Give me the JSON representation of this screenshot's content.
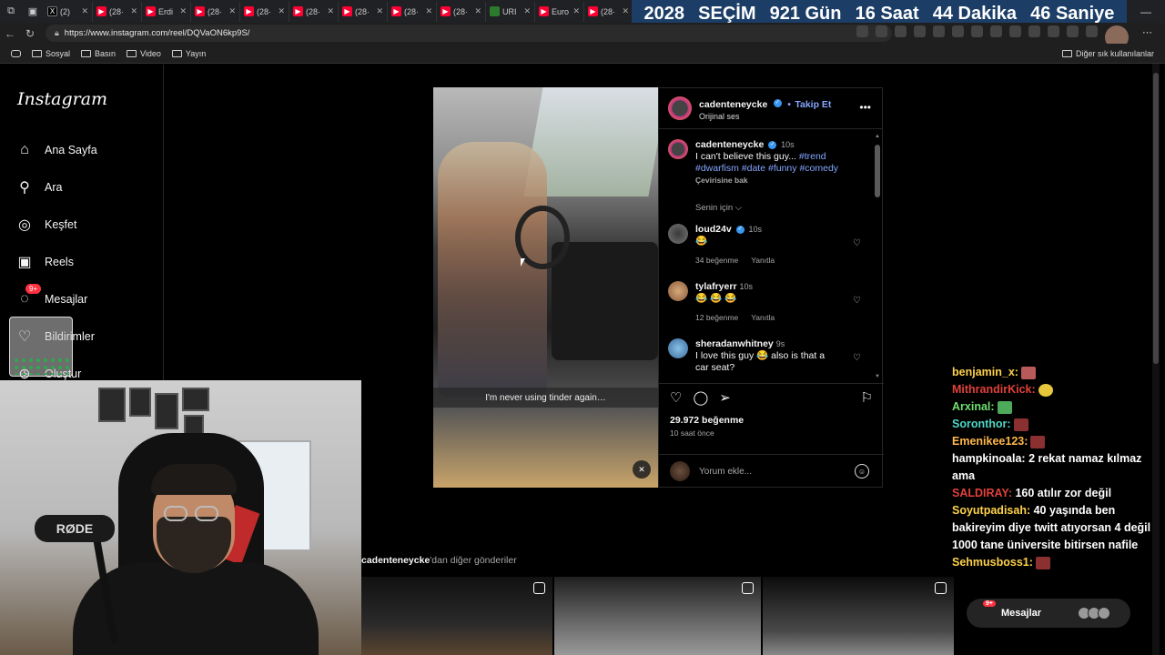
{
  "browser": {
    "tabs": [
      {
        "label": "(2)",
        "fav": "x"
      },
      {
        "label": "(28·",
        "fav": "yt"
      },
      {
        "label": "Erdi",
        "fav": "yt"
      },
      {
        "label": "(28·",
        "fav": "yt"
      },
      {
        "label": "(28·",
        "fav": "yt"
      },
      {
        "label": "(28·",
        "fav": "yt"
      },
      {
        "label": "(28·",
        "fav": "yt"
      },
      {
        "label": "(28·",
        "fav": "yt"
      },
      {
        "label": "(28·",
        "fav": "yt"
      },
      {
        "label": "URI",
        "fav": "gh"
      },
      {
        "label": "Euro",
        "fav": "yt"
      },
      {
        "label": "(28·",
        "fav": "yt"
      }
    ],
    "url": "https://www.instagram.com/reel/DQVaON6kp9S/",
    "bookmarks": [
      "Sosyal",
      "Basın",
      "Video",
      "Yayın"
    ],
    "other_bookmarks": "Diğer sık kullanılanlar"
  },
  "countdown": {
    "year": "2028",
    "label": "SEÇİM",
    "days": "921 Gün",
    "hours": "16 Saat",
    "minutes": "44 Dakika",
    "seconds": "46 Saniye"
  },
  "instagram": {
    "logo": "Instagram",
    "nav": [
      {
        "label": "Ana Sayfa",
        "icon": "home-icon"
      },
      {
        "label": "Ara",
        "icon": "search-icon"
      },
      {
        "label": "Keşfet",
        "icon": "compass-icon"
      },
      {
        "label": "Reels",
        "icon": "reels-icon"
      },
      {
        "label": "Mesajlar",
        "icon": "messenger-icon",
        "badge": "9+"
      },
      {
        "label": "Bildirimler",
        "icon": "heart-icon"
      },
      {
        "label": "Oluştur",
        "icon": "plus-icon"
      }
    ],
    "post": {
      "video_caption": "I'm never using tinder again…",
      "author": "cadenteneycke",
      "follow": "Takip Et",
      "dot": "•",
      "audio": "Orijinal ses",
      "caption_user": "cadenteneycke",
      "caption_time": "10s",
      "caption_text": "I can't believe this guy...",
      "hashtags": [
        "#trend",
        "#dwarfism",
        "#date",
        "#funny",
        "#comedy"
      ],
      "translate": "Çevirisine bak",
      "sort": "Senin için",
      "comments": [
        {
          "user": "loud24v",
          "verified": true,
          "time": "10s",
          "text": "😂",
          "likes": "34 beğenme",
          "reply": "Yanıtla"
        },
        {
          "user": "tylafryerr",
          "verified": false,
          "time": "10s",
          "text": "😂 😂 😂",
          "likes": "12 beğenme",
          "reply": "Yanıtla"
        },
        {
          "user": "sheradanwhitney",
          "verified": false,
          "time": "9s",
          "text_a": "I love this guy",
          "emoji": "😂",
          "text_b": "also is that a car seat?"
        }
      ],
      "likes": "29.972 beğenme",
      "time_ago": "10 saat önce",
      "add_comment": "Yorum ekle..."
    },
    "more_posts": {
      "user": "cadenteneycke",
      "suffix": "'dan diğer gönderiler"
    },
    "messages_popup": {
      "label": "Mesajlar",
      "badge": "9+"
    }
  },
  "webcam": {
    "mic_brand": "RØDE"
  },
  "chat": [
    {
      "user": "benjamin_x:",
      "color": "#ffd24a",
      "msg": "",
      "emote": "pink"
    },
    {
      "user": "MithrandirKick:",
      "color": "#e0413a",
      "msg": "",
      "emote": "yellow"
    },
    {
      "user": "Arxinal:",
      "color": "#6fe06f",
      "msg": "",
      "emote": "green"
    },
    {
      "user": "Soronthor:",
      "color": "#4fd6c8",
      "msg": "",
      "emote": "red"
    },
    {
      "user": "Emenikee123:",
      "color": "#ffb84a",
      "msg": "",
      "emote": "red"
    },
    {
      "user": "hampkinoala:",
      "color": "#ffffff",
      "msg": "2 rekat namaz kılmaz ama",
      "emote": ""
    },
    {
      "user": "SALDIRAY:",
      "color": "#e0413a",
      "msg": "160 atılır zor değil",
      "emote": ""
    },
    {
      "user": "Soyutpadisah:",
      "color": "#ffd24a",
      "msg": "40 yaşında ben bakireyim diye twitt atıyorsan 4 değil 1000 tane üniversite bitirsen nafile",
      "emote": ""
    },
    {
      "user": "Sehmusboss1:",
      "color": "#ffd24a",
      "msg": "",
      "emote": "red"
    }
  ]
}
